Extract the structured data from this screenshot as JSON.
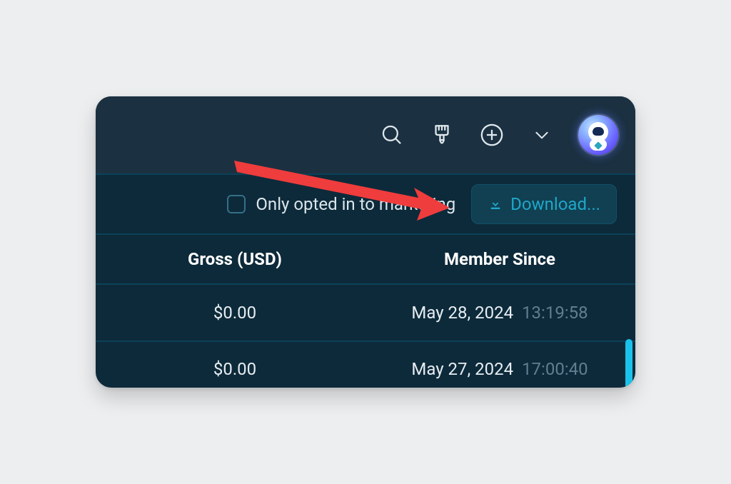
{
  "filter": {
    "checkbox_label": "Only opted in to marketing",
    "download_label": "Download..."
  },
  "table": {
    "headers": {
      "gross": "Gross (USD)",
      "since": "Member Since"
    },
    "rows": [
      {
        "gross": "$0.00",
        "since_date": "May 28, 2024",
        "since_time": "13:19:58"
      },
      {
        "gross": "$0.00",
        "since_date": "May 27, 2024",
        "since_time": "17:00:40"
      }
    ]
  }
}
